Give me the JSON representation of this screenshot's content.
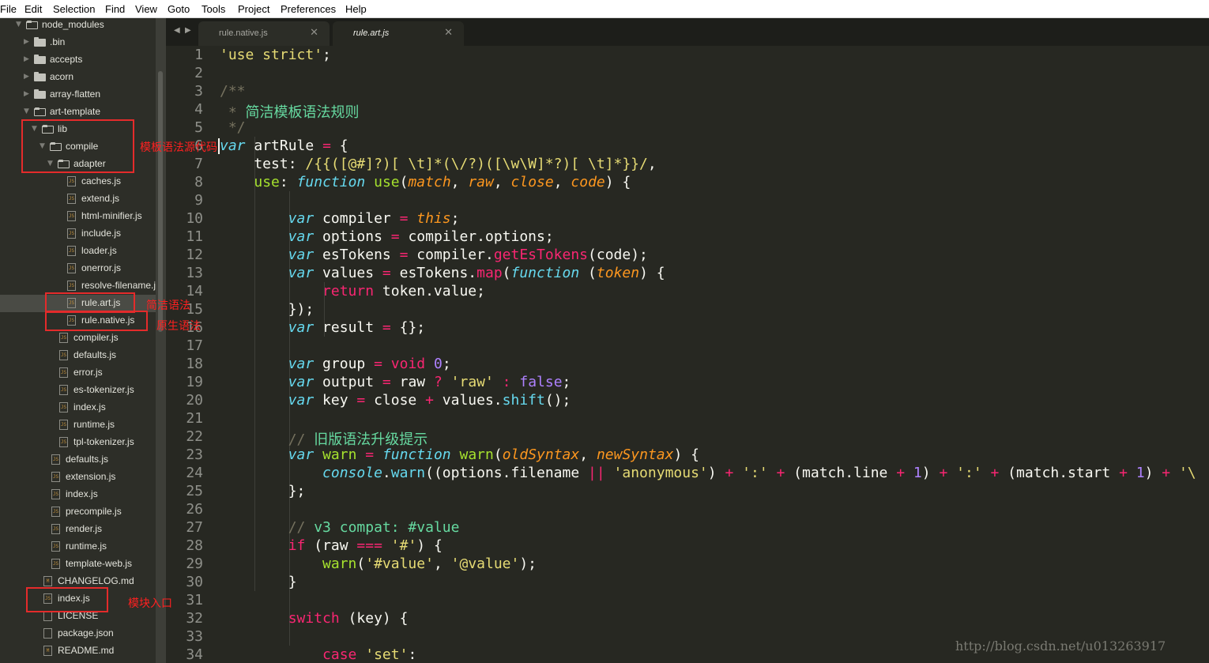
{
  "menubar": [
    "File",
    "Edit",
    "Selection",
    "Find",
    "View",
    "Goto",
    "Tools",
    "Project",
    "Preferences",
    "Help"
  ],
  "sidebar": {
    "items": [
      {
        "label": "node_modules",
        "type": "folder",
        "open": true,
        "depth": 1
      },
      {
        "label": ".bin",
        "type": "folder",
        "open": false,
        "depth": 2
      },
      {
        "label": "accepts",
        "type": "folder",
        "open": false,
        "depth": 2
      },
      {
        "label": "acorn",
        "type": "folder",
        "open": false,
        "depth": 2
      },
      {
        "label": "array-flatten",
        "type": "folder",
        "open": false,
        "depth": 2
      },
      {
        "label": "art-template",
        "type": "folder",
        "open": true,
        "depth": 2
      },
      {
        "label": "lib",
        "type": "folder",
        "open": true,
        "depth": 3
      },
      {
        "label": "compile",
        "type": "folder",
        "open": true,
        "depth": 4
      },
      {
        "label": "adapter",
        "type": "folder",
        "open": true,
        "depth": 5
      },
      {
        "label": "caches.js",
        "type": "js",
        "depth": 6
      },
      {
        "label": "extend.js",
        "type": "js",
        "depth": 6
      },
      {
        "label": "html-minifier.js",
        "type": "js",
        "depth": 6
      },
      {
        "label": "include.js",
        "type": "js",
        "depth": 6
      },
      {
        "label": "loader.js",
        "type": "js",
        "depth": 6
      },
      {
        "label": "onerror.js",
        "type": "js",
        "depth": 6
      },
      {
        "label": "resolve-filename.js",
        "type": "js",
        "depth": 6
      },
      {
        "label": "rule.art.js",
        "type": "js",
        "depth": 6,
        "selected": true
      },
      {
        "label": "rule.native.js",
        "type": "js",
        "depth": 6
      },
      {
        "label": "compiler.js",
        "type": "js",
        "depth": 5
      },
      {
        "label": "defaults.js",
        "type": "js",
        "depth": 5
      },
      {
        "label": "error.js",
        "type": "js",
        "depth": 5
      },
      {
        "label": "es-tokenizer.js",
        "type": "js",
        "depth": 5
      },
      {
        "label": "index.js",
        "type": "js",
        "depth": 5
      },
      {
        "label": "runtime.js",
        "type": "js",
        "depth": 5
      },
      {
        "label": "tpl-tokenizer.js",
        "type": "js",
        "depth": 5
      },
      {
        "label": "defaults.js",
        "type": "js",
        "depth": 4
      },
      {
        "label": "extension.js",
        "type": "js",
        "depth": 4
      },
      {
        "label": "index.js",
        "type": "js",
        "depth": 4
      },
      {
        "label": "precompile.js",
        "type": "js",
        "depth": 4
      },
      {
        "label": "render.js",
        "type": "js",
        "depth": 4
      },
      {
        "label": "runtime.js",
        "type": "js",
        "depth": 4
      },
      {
        "label": "template-web.js",
        "type": "js",
        "depth": 4
      },
      {
        "label": "CHANGELOG.md",
        "type": "md",
        "depth": 3
      },
      {
        "label": "index.js",
        "type": "js",
        "depth": 3
      },
      {
        "label": "LICENSE",
        "type": "txt",
        "depth": 3
      },
      {
        "label": "package.json",
        "type": "json",
        "depth": 3
      },
      {
        "label": "README.md",
        "type": "md",
        "depth": 3
      }
    ]
  },
  "annotations": [
    {
      "text": "模板语法源代码",
      "row": 7
    },
    {
      "text": "简洁语法",
      "row": 16
    },
    {
      "text": "原生语法",
      "row": 17
    },
    {
      "text": "模块入口",
      "row": 33
    }
  ],
  "tabs": [
    {
      "label": "rule.native.js",
      "active": false
    },
    {
      "label": "rule.art.js",
      "active": true
    }
  ],
  "editor": {
    "lines": [
      [
        [
          "s",
          "'use strict'"
        ],
        [
          "",
          ";"
        ]
      ],
      [],
      [
        [
          "c",
          "/**"
        ]
      ],
      [
        [
          "c",
          " * "
        ],
        [
          "cg",
          "简洁模板语法规则"
        ]
      ],
      [
        [
          "c",
          " */"
        ]
      ],
      [
        [
          "st",
          "var"
        ],
        [
          "",
          " artRule "
        ],
        [
          "k",
          "="
        ],
        [
          "",
          " {"
        ]
      ],
      [
        [
          "",
          "    test: "
        ],
        [
          "s",
          "/{{([@#]?)[ \\t]*(\\/?)([\\w\\W]*?)[ \\t]*}}/"
        ],
        [
          "",
          ","
        ]
      ],
      [
        [
          "",
          "    "
        ],
        [
          "f",
          "use"
        ],
        [
          "",
          ": "
        ],
        [
          "st",
          "function"
        ],
        [
          "",
          " "
        ],
        [
          "f",
          "use"
        ],
        [
          "",
          "("
        ],
        [
          "p",
          "match"
        ],
        [
          "",
          ", "
        ],
        [
          "p",
          "raw"
        ],
        [
          "",
          ", "
        ],
        [
          "p",
          "close"
        ],
        [
          "",
          ", "
        ],
        [
          "p",
          "code"
        ],
        [
          "",
          ") {"
        ]
      ],
      [],
      [
        [
          "",
          "        "
        ],
        [
          "st",
          "var"
        ],
        [
          "",
          " compiler "
        ],
        [
          "k",
          "="
        ],
        [
          "",
          " "
        ],
        [
          "p",
          "this"
        ],
        [
          "",
          ";"
        ]
      ],
      [
        [
          "",
          "        "
        ],
        [
          "st",
          "var"
        ],
        [
          "",
          " options "
        ],
        [
          "k",
          "="
        ],
        [
          "",
          " compiler.options;"
        ]
      ],
      [
        [
          "",
          "        "
        ],
        [
          "st",
          "var"
        ],
        [
          "",
          " esTokens "
        ],
        [
          "k",
          "="
        ],
        [
          "",
          " compiler."
        ],
        [
          "k",
          "getEsTokens"
        ],
        [
          "",
          "(code);"
        ]
      ],
      [
        [
          "",
          "        "
        ],
        [
          "st",
          "var"
        ],
        [
          "",
          " values "
        ],
        [
          "k",
          "="
        ],
        [
          "",
          " esTokens."
        ],
        [
          "k",
          "map"
        ],
        [
          "",
          "("
        ],
        [
          "st",
          "function"
        ],
        [
          "",
          " ("
        ],
        [
          "p",
          "token"
        ],
        [
          "",
          ") {"
        ]
      ],
      [
        [
          "",
          "            "
        ],
        [
          "k",
          "return"
        ],
        [
          "",
          " token.value;"
        ]
      ],
      [
        [
          "",
          "        });"
        ]
      ],
      [
        [
          "",
          "        "
        ],
        [
          "st",
          "var"
        ],
        [
          "",
          " result "
        ],
        [
          "k",
          "="
        ],
        [
          "",
          " {};"
        ]
      ],
      [],
      [
        [
          "",
          "        "
        ],
        [
          "st",
          "var"
        ],
        [
          "",
          " group "
        ],
        [
          "k",
          "="
        ],
        [
          "",
          " "
        ],
        [
          "k",
          "void"
        ],
        [
          "",
          " "
        ],
        [
          "n",
          "0"
        ],
        [
          "",
          ";"
        ]
      ],
      [
        [
          "",
          "        "
        ],
        [
          "st",
          "var"
        ],
        [
          "",
          " output "
        ],
        [
          "k",
          "="
        ],
        [
          "",
          " raw "
        ],
        [
          "k",
          "?"
        ],
        [
          "",
          " "
        ],
        [
          "s",
          "'raw'"
        ],
        [
          "",
          " "
        ],
        [
          "k",
          ":"
        ],
        [
          "",
          " "
        ],
        [
          "n",
          "false"
        ],
        [
          "",
          ";"
        ]
      ],
      [
        [
          "",
          "        "
        ],
        [
          "st",
          "var"
        ],
        [
          "",
          " key "
        ],
        [
          "k",
          "="
        ],
        [
          "",
          " close "
        ],
        [
          "k",
          "+"
        ],
        [
          "",
          " values."
        ],
        [
          "b",
          "shift"
        ],
        [
          "",
          "();"
        ]
      ],
      [],
      [
        [
          "",
          "        "
        ],
        [
          "c",
          "// "
        ],
        [
          "cg",
          "旧版语法升级提示"
        ]
      ],
      [
        [
          "",
          "        "
        ],
        [
          "st",
          "var"
        ],
        [
          "",
          " "
        ],
        [
          "f",
          "warn"
        ],
        [
          "",
          " "
        ],
        [
          "k",
          "="
        ],
        [
          "",
          " "
        ],
        [
          "st",
          "function"
        ],
        [
          "",
          " "
        ],
        [
          "f",
          "warn"
        ],
        [
          "",
          "("
        ],
        [
          "p",
          "oldSyntax"
        ],
        [
          "",
          ", "
        ],
        [
          "p",
          "newSyntax"
        ],
        [
          "",
          ") {"
        ]
      ],
      [
        [
          "",
          "            "
        ],
        [
          "st",
          "console"
        ],
        [
          "",
          "."
        ],
        [
          "b",
          "warn"
        ],
        [
          "",
          "((options.filename "
        ],
        [
          "k",
          "||"
        ],
        [
          "",
          " "
        ],
        [
          "s",
          "'anonymous'"
        ],
        [
          "",
          ") "
        ],
        [
          "k",
          "+"
        ],
        [
          "",
          " "
        ],
        [
          "s",
          "':'"
        ],
        [
          "",
          " "
        ],
        [
          "k",
          "+"
        ],
        [
          "",
          " (match.line "
        ],
        [
          "k",
          "+"
        ],
        [
          "",
          " "
        ],
        [
          "n",
          "1"
        ],
        [
          "",
          ") "
        ],
        [
          "k",
          "+"
        ],
        [
          "",
          " "
        ],
        [
          "s",
          "':'"
        ],
        [
          "",
          " "
        ],
        [
          "k",
          "+"
        ],
        [
          "",
          " (match.start "
        ],
        [
          "k",
          "+"
        ],
        [
          "",
          " "
        ],
        [
          "n",
          "1"
        ],
        [
          "",
          ") "
        ],
        [
          "k",
          "+"
        ],
        [
          "",
          " "
        ],
        [
          "s",
          "'\\"
        ]
      ],
      [
        [
          "",
          "        };"
        ]
      ],
      [],
      [
        [
          "",
          "        "
        ],
        [
          "c",
          "// "
        ],
        [
          "cg",
          "v3 compat: #value"
        ]
      ],
      [
        [
          "",
          "        "
        ],
        [
          "k",
          "if"
        ],
        [
          "",
          " (raw "
        ],
        [
          "k",
          "==="
        ],
        [
          "",
          " "
        ],
        [
          "s",
          "'#'"
        ],
        [
          "",
          ") {"
        ]
      ],
      [
        [
          "",
          "            "
        ],
        [
          "f",
          "warn"
        ],
        [
          "",
          "("
        ],
        [
          "s",
          "'#value'"
        ],
        [
          "",
          ", "
        ],
        [
          "s",
          "'@value'"
        ],
        [
          "",
          ");"
        ]
      ],
      [
        [
          "",
          "        }"
        ]
      ],
      [],
      [
        [
          "",
          "        "
        ],
        [
          "k",
          "switch"
        ],
        [
          "",
          " (key) {"
        ]
      ],
      [],
      [
        [
          "",
          "            "
        ],
        [
          "k",
          "case"
        ],
        [
          "",
          " "
        ],
        [
          "s",
          "'set'"
        ],
        [
          "",
          ":"
        ]
      ]
    ]
  },
  "watermark": "http://blog.csdn.net/u013263917",
  "colors": {
    "accent": "#e42b2b",
    "editor_bg": "#272822"
  }
}
